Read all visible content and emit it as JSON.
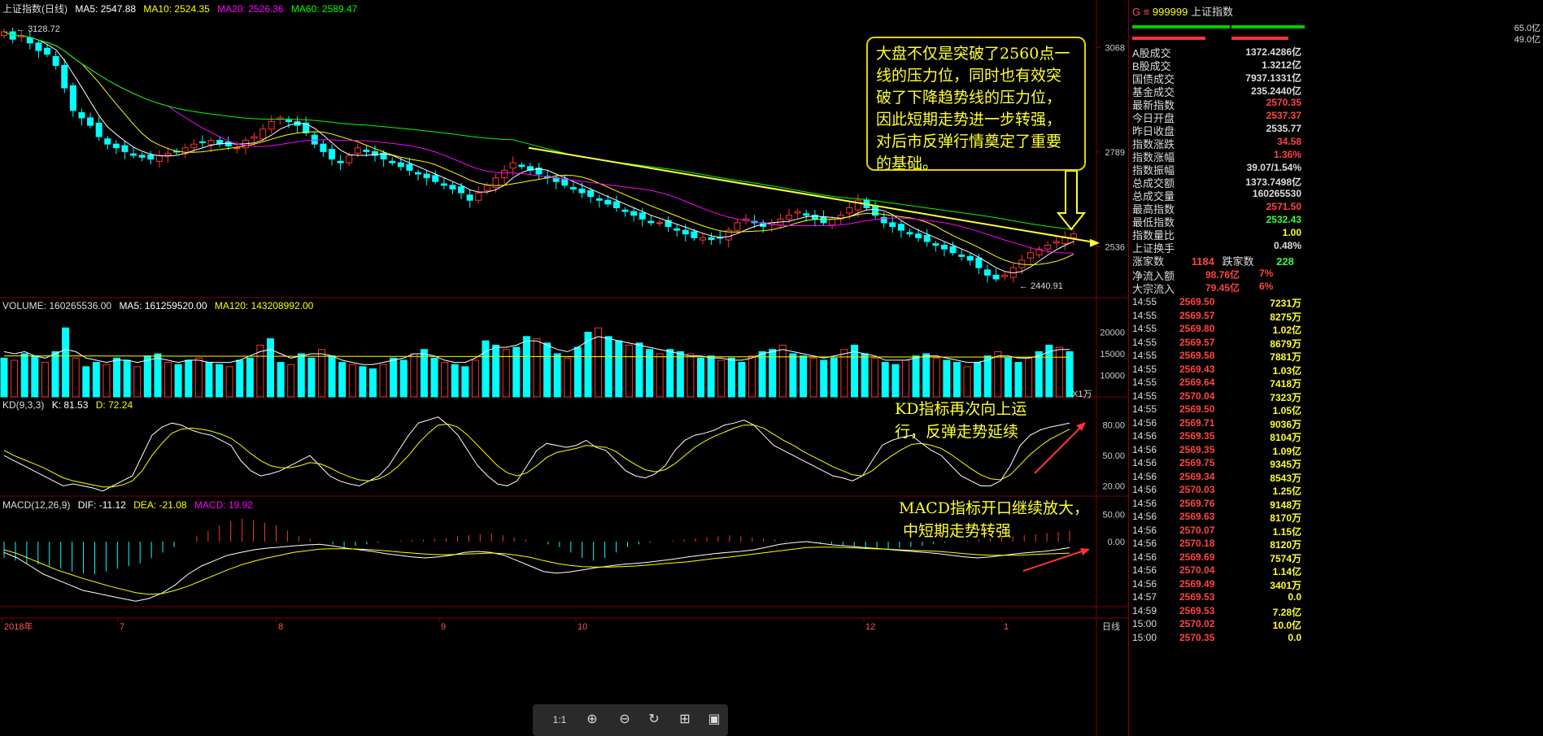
{
  "header": {
    "index_name": "上证指数(日线)",
    "ma5": "MA5: 2547.88",
    "ma10": "MA10: 2524.35",
    "ma20": "MA20: 2526.36",
    "ma60": "MA60: 2589.47",
    "volume": "VOLUME: 160265536.00",
    "vol_ma5": "MA5: 161259520.00",
    "vol_ma120": "MA120: 143208992.00",
    "kd": "KD(9,3,3)",
    "kd_k": "K: 81.53",
    "kd_d": "D: 72.24",
    "macd": "MACD(12,26,9)",
    "macd_dif": "DIF: -11.12",
    "macd_dea": "DEA: -21.08",
    "macd_val": "MACD: 19.92",
    "high_label": "3128.72",
    "low_label": "2440.91",
    "vol_unit": "X1万"
  },
  "annotations": {
    "box_text": "大盘不仅是突破了2560点一线的压力位，同时也有效突破了下降趋势线的压力位，因此短期走势进一步转强，对后市反弹行情奠定了重要的基础。",
    "kd_text_1": "KD指标再次向上运",
    "kd_text_2": "行，反弹走势延续",
    "macd_text_1": "MACD指标开口继续放大，",
    "macd_text_2": "中短期走势转强"
  },
  "axis": {
    "price_ticks": [
      "3068",
      "2789",
      "2536"
    ],
    "vol_ticks": [
      "20000",
      "15000",
      "10000"
    ],
    "kd_ticks": [
      "80.00",
      "50.00",
      "20.00"
    ],
    "macd_ticks": [
      "50.00",
      "0.00"
    ],
    "x_ticks": [
      "2018年",
      "7",
      "8",
      "9",
      "10",
      "12",
      "1"
    ],
    "period": "日线"
  },
  "panel": {
    "code": "999999",
    "name": "上证指数",
    "up_pct": "65.0亿",
    "down_pct": "49.0亿",
    "stats": [
      {
        "label": "A股成交",
        "value": "1372.4286亿",
        "color": "#dddddd"
      },
      {
        "label": "B股成交",
        "value": "1.3212亿",
        "color": "#dddddd"
      },
      {
        "label": "国债成交",
        "value": "7937.1331亿",
        "color": "#dddddd"
      },
      {
        "label": "基金成交",
        "value": "235.2440亿",
        "color": "#dddddd"
      },
      {
        "label": "最新指数",
        "value": "2570.35",
        "color": "#ff4444"
      },
      {
        "label": "今日开盘",
        "value": "2537.37",
        "color": "#ff4444"
      },
      {
        "label": "昨日收盘",
        "value": "2535.77",
        "color": "#dddddd"
      },
      {
        "label": "指数涨跌",
        "value": "34.58",
        "color": "#ff4444"
      },
      {
        "label": "指数涨幅",
        "value": "1.36%",
        "color": "#ff4444"
      },
      {
        "label": "指数振幅",
        "value": "39.07/1.54%",
        "color": "#dddddd"
      },
      {
        "label": "总成交额",
        "value": "1373.7498亿",
        "color": "#dddddd"
      },
      {
        "label": "总成交量",
        "value": "160265530",
        "color": "#dddddd"
      },
      {
        "label": "最高指数",
        "value": "2571.50",
        "color": "#ff4444"
      },
      {
        "label": "最低指数",
        "value": "2532.43",
        "color": "#33ff33"
      },
      {
        "label": "指数量比",
        "value": "1.00",
        "color": "#ffff33"
      },
      {
        "label": "上证换手",
        "value": "0.48%",
        "color": "#dddddd"
      }
    ],
    "up_label": "涨家数",
    "up_count": "1184",
    "down_label": "跌家数",
    "down_count": "228",
    "inflow_label": "净流入额",
    "inflow_value": "98.76亿",
    "inflow_pct": "7%",
    "big_label": "大宗流入",
    "big_value": "79.45亿",
    "big_pct": "6%",
    "ticks": [
      [
        "14:55",
        "2569.50",
        "7231万"
      ],
      [
        "14:55",
        "2569.57",
        "8275万"
      ],
      [
        "14:55",
        "2569.80",
        "1.02亿"
      ],
      [
        "14:55",
        "2569.57",
        "8679万"
      ],
      [
        "14:55",
        "2569.58",
        "7881万"
      ],
      [
        "14:55",
        "2569.43",
        "1.03亿"
      ],
      [
        "14:55",
        "2569.64",
        "7418万"
      ],
      [
        "14:55",
        "2570.04",
        "7323万"
      ],
      [
        "14:55",
        "2569.50",
        "1.05亿"
      ],
      [
        "14:56",
        "2569.71",
        "9036万"
      ],
      [
        "14:56",
        "2569.35",
        "8104万"
      ],
      [
        "14:56",
        "2569.35",
        "1.09亿"
      ],
      [
        "14:56",
        "2569.75",
        "9345万"
      ],
      [
        "14:56",
        "2569.34",
        "8543万"
      ],
      [
        "14:56",
        "2570.03",
        "1.25亿"
      ],
      [
        "14:56",
        "2569.76",
        "9148万"
      ],
      [
        "14:56",
        "2569.63",
        "8170万"
      ],
      [
        "14:56",
        "2570.07",
        "1.15亿"
      ],
      [
        "14:56",
        "2570.18",
        "8120万"
      ],
      [
        "14:56",
        "2569.69",
        "7574万"
      ],
      [
        "14:56",
        "2570.04",
        "1.14亿"
      ],
      [
        "14:56",
        "2569.49",
        "3401万"
      ],
      [
        "14:57",
        "2569.53",
        "0.0"
      ],
      [
        "14:59",
        "2569.53",
        "7.28亿"
      ],
      [
        "15:00",
        "2570.02",
        "10.0亿"
      ],
      [
        "15:00",
        "2570.35",
        "0.0"
      ]
    ]
  },
  "chart_data": [
    {
      "type": "candlestick",
      "title": "上证指数(日线)",
      "ylim": [
        2400,
        3160
      ],
      "x_range": [
        "2018年",
        "1"
      ],
      "close": [
        3110,
        3090,
        3100,
        3080,
        3060,
        3050,
        3020,
        2960,
        2900,
        2880,
        2860,
        2830,
        2810,
        2800,
        2790,
        2780,
        2775,
        2770,
        2780,
        2785,
        2790,
        2800,
        2810,
        2815,
        2820,
        2810,
        2805,
        2800,
        2820,
        2830,
        2850,
        2870,
        2880,
        2870,
        2860,
        2840,
        2810,
        2790,
        2770,
        2760,
        2780,
        2800,
        2790,
        2780,
        2770,
        2760,
        2750,
        2740,
        2730,
        2720,
        2710,
        2700,
        2690,
        2680,
        2660,
        2680,
        2700,
        2720,
        2740,
        2760,
        2750,
        2740,
        2730,
        2720,
        2710,
        2700,
        2690,
        2680,
        2670,
        2660,
        2650,
        2640,
        2630,
        2620,
        2610,
        2600,
        2600,
        2590,
        2580,
        2570,
        2560,
        2560,
        2555,
        2560,
        2580,
        2600,
        2610,
        2600,
        2590,
        2600,
        2610,
        2620,
        2630,
        2620,
        2610,
        2600,
        2610,
        2620,
        2640,
        2660,
        2640,
        2620,
        2600,
        2590,
        2580,
        2570,
        2560,
        2550,
        2540,
        2530,
        2520,
        2510,
        2500,
        2480,
        2460,
        2450,
        2460,
        2480,
        2500,
        2520,
        2530,
        2540,
        2550,
        2560,
        2570
      ]
    },
    {
      "type": "bar",
      "title": "VOLUME",
      "ylim": [
        5000,
        25000
      ],
      "values": [
        14000,
        13500,
        15000,
        14500,
        13000,
        15500,
        21000,
        14000,
        12000,
        13000,
        12500,
        14000,
        13500,
        12000,
        14500,
        15000,
        13000,
        12500,
        13500,
        14000,
        13000,
        12500,
        12000,
        13500,
        14000,
        17000,
        18500,
        13000,
        12500,
        15000,
        14000,
        16000,
        14500,
        13000,
        12500,
        12000,
        11500,
        12500,
        14000,
        13500,
        15000,
        16000,
        14000,
        13000,
        12500,
        12000,
        13500,
        18000,
        17000,
        16000,
        16500,
        19000,
        18500,
        17500,
        15000,
        14000,
        16500,
        20000,
        21000,
        19000,
        18000,
        17000,
        17500,
        16000,
        15000,
        16000,
        15500,
        15000,
        14000,
        14500,
        13500,
        14000,
        13000,
        14500,
        15500,
        16000,
        17000,
        15000,
        14500,
        14000,
        13500,
        14000,
        16000,
        17000,
        15000,
        14000,
        13000,
        12500,
        13500,
        14500,
        15000,
        14000,
        13500,
        13000,
        12000,
        13000,
        14500,
        15500,
        14000,
        13000,
        14000,
        15500,
        17000,
        16500,
        15500
      ],
      "ma5": [
        15500,
        15000,
        15500,
        14500,
        14000,
        15000,
        16000,
        15500,
        14000,
        13500,
        13000,
        13500,
        13500,
        13000,
        13500,
        14000,
        13500,
        13000,
        13500,
        13500,
        13000,
        13000,
        13000,
        13500,
        14500,
        15500,
        16000,
        15000,
        14000,
        14500,
        15000,
        15000,
        14500,
        13500,
        13000,
        12500,
        12500,
        13000,
        13500,
        14000,
        15000,
        15000,
        14500,
        13500,
        13000,
        13000,
        14000,
        15500,
        16500,
        16500,
        17000,
        18000,
        18000,
        17000,
        16000,
        15500,
        16500,
        18000,
        19000,
        18500,
        18000,
        17500,
        17000,
        16500,
        16000,
        15500,
        15000,
        14500,
        14500,
        14000,
        14000,
        13500,
        13500,
        14000,
        15000,
        15500,
        16000,
        15500,
        15000,
        14500,
        14000,
        14500,
        15000,
        15500,
        15000,
        14500,
        13500,
        13500,
        13500,
        14000,
        14500,
        14500,
        14000,
        13500,
        13000,
        13000,
        13500,
        14500,
        14500,
        14000,
        14000,
        14500,
        15500,
        16000,
        16000
      ]
    },
    {
      "type": "line",
      "title": "KD(9,3,3)",
      "ylim": [
        10,
        95
      ],
      "series": [
        {
          "name": "K",
          "values": [
            50,
            45,
            40,
            35,
            30,
            25,
            20,
            22,
            20,
            18,
            15,
            20,
            25,
            30,
            50,
            70,
            78,
            82,
            80,
            75,
            72,
            70,
            65,
            60,
            45,
            35,
            30,
            32,
            35,
            40,
            45,
            50,
            40,
            30,
            25,
            22,
            20,
            25,
            30,
            40,
            55,
            70,
            82,
            85,
            88,
            80,
            70,
            55,
            40,
            30,
            22,
            20,
            25,
            40,
            55,
            62,
            60,
            58,
            60,
            65,
            58,
            55,
            45,
            35,
            30,
            28,
            32,
            40,
            55,
            65,
            70,
            72,
            75,
            80,
            82,
            85,
            80,
            70,
            60,
            55,
            50,
            45,
            40,
            35,
            30,
            28,
            25,
            30,
            45,
            60,
            65,
            68,
            70,
            62,
            55,
            50,
            40,
            30,
            25,
            20,
            20,
            25,
            40,
            60,
            70,
            75,
            78,
            80,
            82
          ]
        },
        {
          "name": "D",
          "values": [
            55,
            50,
            46,
            42,
            38,
            33,
            28,
            25,
            23,
            21,
            19,
            19,
            21,
            25,
            35,
            50,
            62,
            72,
            76,
            77,
            76,
            74,
            71,
            67,
            60,
            52,
            45,
            40,
            38,
            38,
            40,
            43,
            42,
            38,
            33,
            29,
            26,
            25,
            27,
            32,
            40,
            50,
            62,
            72,
            80,
            81,
            78,
            70,
            60,
            50,
            40,
            33,
            30,
            33,
            40,
            48,
            53,
            55,
            57,
            60,
            59,
            58,
            54,
            47,
            41,
            36,
            34,
            36,
            42,
            50,
            58,
            64,
            69,
            73,
            77,
            80,
            80,
            77,
            71,
            65,
            60,
            54,
            49,
            44,
            39,
            35,
            31,
            30,
            35,
            43,
            50,
            56,
            61,
            62,
            60,
            57,
            51,
            44,
            37,
            31,
            27,
            26,
            31,
            41,
            51,
            59,
            66,
            71,
            76
          ]
        }
      ]
    },
    {
      "type": "bar",
      "title": "MACD(12,26,9)",
      "ylim": [
        -120,
        60
      ],
      "values": [
        -30,
        -35,
        -40,
        -42,
        -45,
        -50,
        -55,
        -58,
        -60,
        -55,
        -50,
        -45,
        -40,
        -30,
        -20,
        -10,
        0,
        10,
        20,
        30,
        38,
        42,
        40,
        35,
        30,
        20,
        10,
        5,
        0,
        -5,
        -10,
        -8,
        -5,
        -2,
        0,
        2,
        3,
        4,
        5,
        6,
        10,
        12,
        14,
        15,
        12,
        8,
        4,
        0,
        -5,
        -10,
        -20,
        -30,
        -35,
        -30,
        -20,
        -10,
        -5,
        -2,
        0,
        2,
        4,
        6,
        8,
        10,
        12,
        10,
        8,
        6,
        4,
        2,
        0,
        -2,
        -4,
        -6,
        -8,
        -10,
        -12,
        -14,
        -15,
        -12,
        -10,
        -8,
        -5,
        -2,
        0,
        2,
        4,
        6,
        8,
        10,
        12,
        14,
        16,
        18,
        19.92
      ],
      "series": [
        {
          "name": "DIF",
          "values": [
            -20,
            -30,
            -45,
            -60,
            -70,
            -80,
            -90,
            -95,
            -100,
            -105,
            -110,
            -105,
            -95,
            -80,
            -60,
            -45,
            -35,
            -25,
            -20,
            -15,
            -12,
            -10,
            -8,
            -6,
            -5,
            -8,
            -12,
            -15,
            -18,
            -22,
            -25,
            -28,
            -30,
            -28,
            -25,
            -20,
            -18,
            -20,
            -25,
            -35,
            -45,
            -55,
            -58,
            -56,
            -52,
            -48,
            -45,
            -42,
            -40,
            -38,
            -35,
            -32,
            -28,
            -25,
            -22,
            -20,
            -18,
            -15,
            -10,
            -5,
            -2,
            0,
            -3,
            -6,
            -8,
            -10,
            -12,
            -14,
            -16,
            -18,
            -20,
            -22,
            -25,
            -28,
            -30,
            -28,
            -25,
            -22,
            -20,
            -18,
            -15,
            -11.12
          ]
        },
        {
          "name": "DEA",
          "values": [
            -15,
            -22,
            -32,
            -42,
            -52,
            -60,
            -68,
            -75,
            -82,
            -88,
            -94,
            -97,
            -96,
            -90,
            -82,
            -72,
            -62,
            -52,
            -43,
            -36,
            -30,
            -25,
            -20,
            -17,
            -14,
            -13,
            -13,
            -14,
            -15,
            -17,
            -19,
            -21,
            -23,
            -24,
            -24,
            -23,
            -22,
            -21,
            -22,
            -25,
            -29,
            -35,
            -40,
            -44,
            -46,
            -47,
            -47,
            -46,
            -45,
            -43,
            -41,
            -39,
            -37,
            -34,
            -31,
            -29,
            -26,
            -23,
            -20,
            -17,
            -14,
            -11,
            -10,
            -10,
            -11,
            -12,
            -13,
            -14,
            -15,
            -16,
            -17,
            -18,
            -20,
            -22,
            -24,
            -25,
            -25,
            -25,
            -24,
            -23,
            -22,
            -21.08
          ]
        }
      ]
    }
  ],
  "colors": {
    "up": "#ff3333",
    "down": "#00ffff",
    "ma5": "#ffffff",
    "ma10": "#ffff00",
    "ma20": "#ff00ff",
    "ma60": "#00ff00",
    "grid": "#800000",
    "trend": "#ffff33"
  }
}
